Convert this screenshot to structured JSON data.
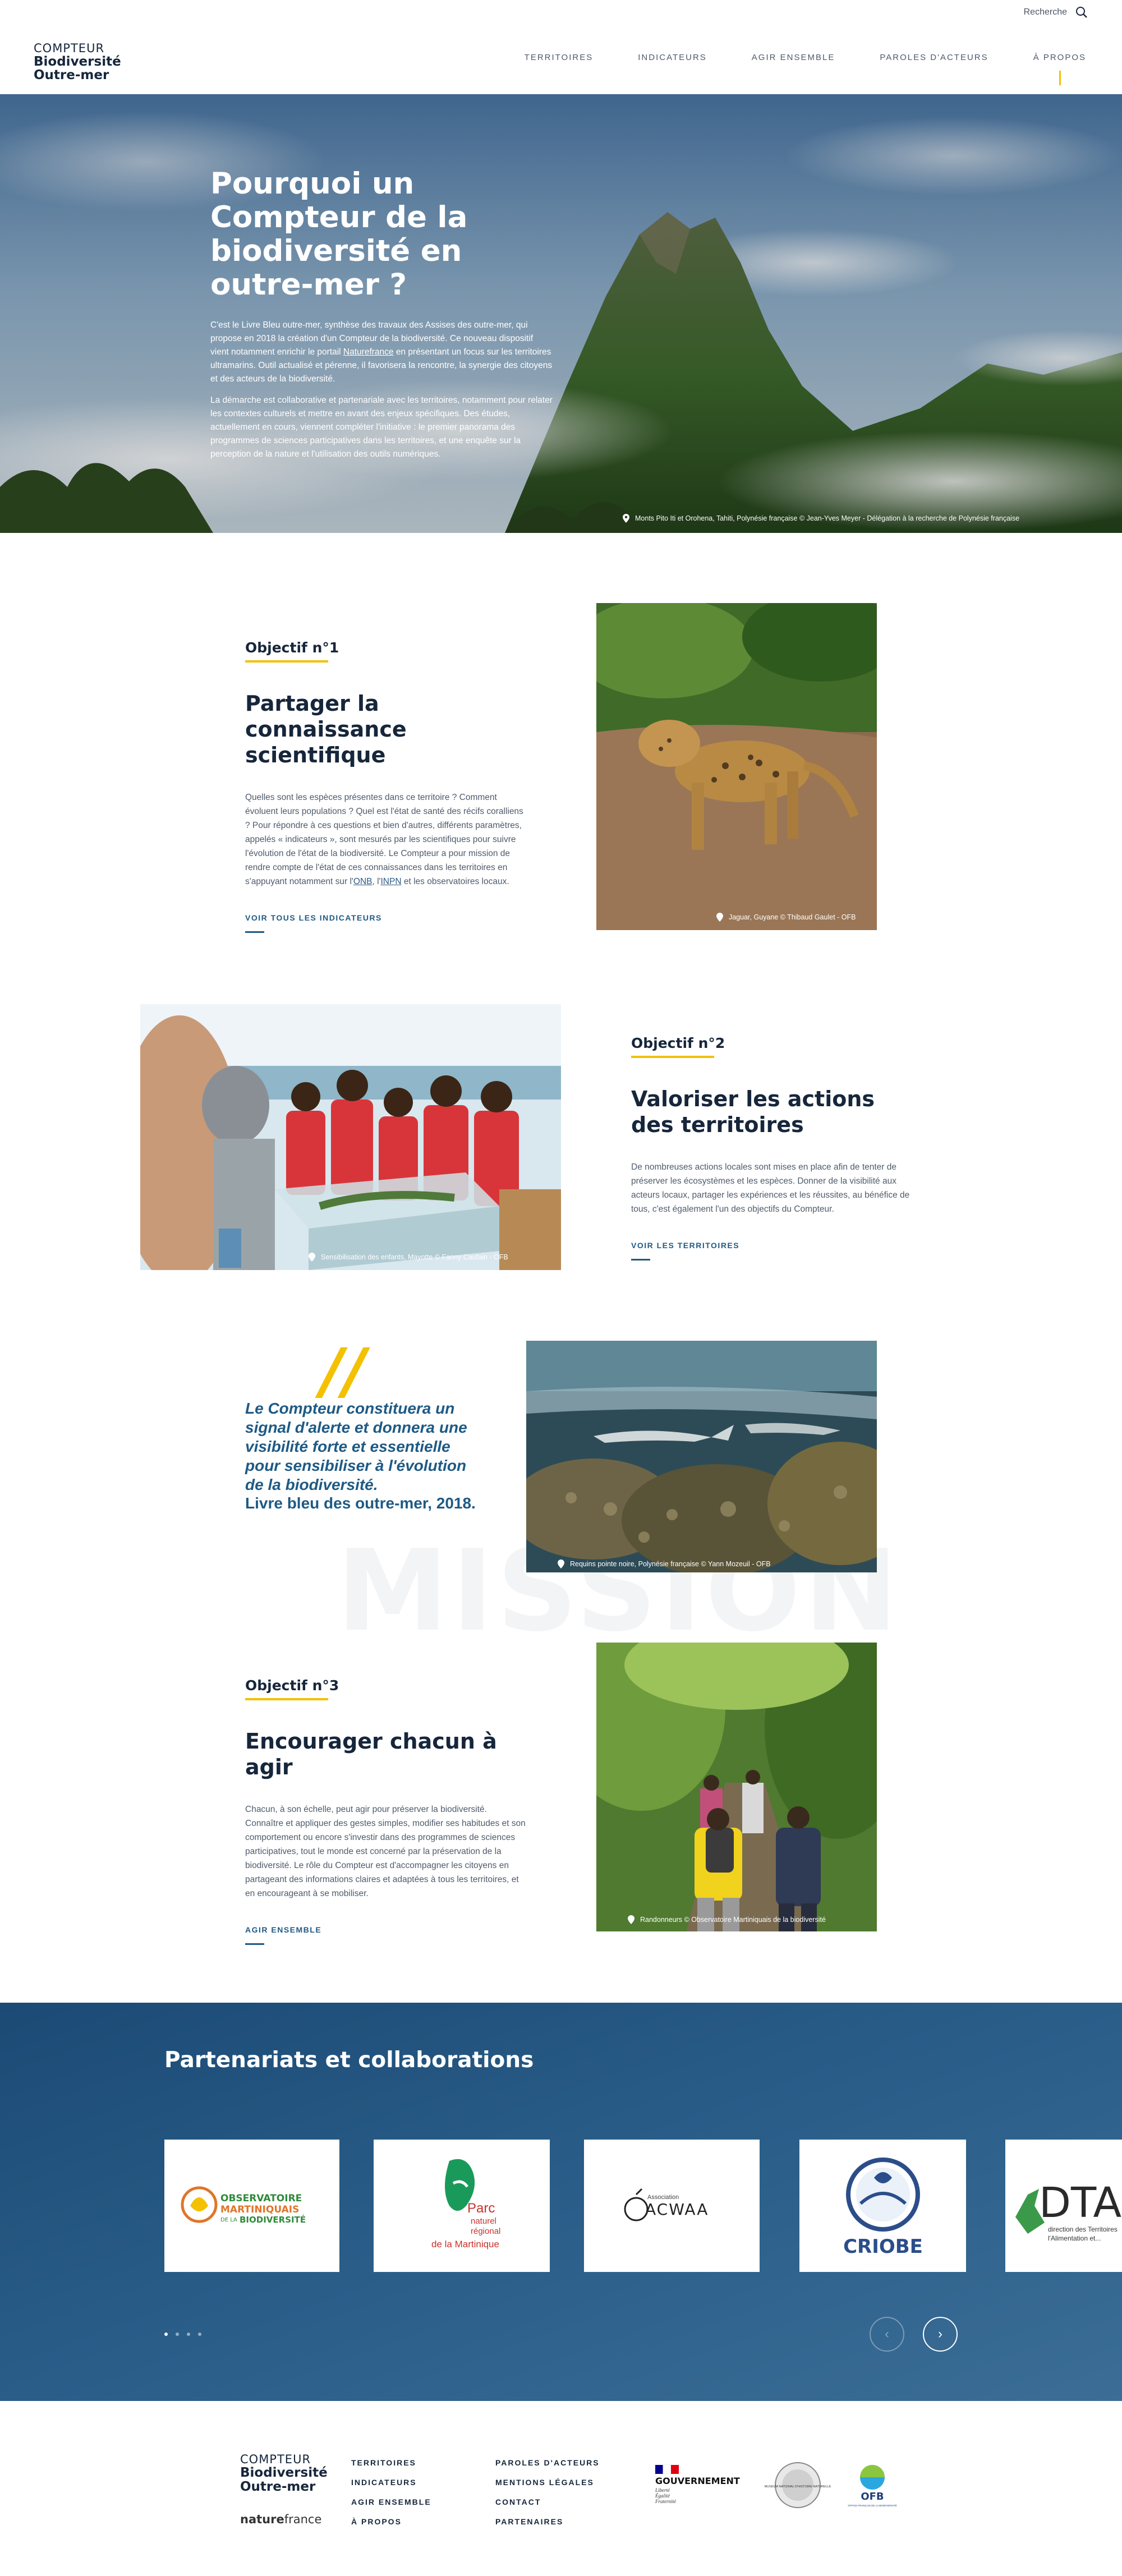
{
  "header": {
    "search_label": "Recherche",
    "logo": {
      "line1": "COMPTEUR",
      "line2": "Biodiversité",
      "line3": "Outre-mer"
    },
    "nav": [
      {
        "label": "TERRITOIRES"
      },
      {
        "label": "INDICATEURS"
      },
      {
        "label": "AGIR ENSEMBLE"
      },
      {
        "label": "PAROLES D'ACTEURS"
      },
      {
        "label": "À PROPOS"
      }
    ]
  },
  "hero": {
    "title": "Pourquoi un Compteur de la biodiversité en outre-mer ?",
    "p1_a": "C'est le Livre Bleu outre-mer, synthèse des travaux des Assises des outre-mer, qui propose en 2018 la création d'un Compteur de la biodiversité. Ce nouveau dispositif vient notamment enrichir le portail ",
    "p1_link": "Naturefrance",
    "p1_b": " en présentant un focus sur les territoires ultramarins. Outil actualisé et pérenne, il favorisera la rencontre, la synergie des citoyens et des acteurs de la biodiversité.",
    "p2": "La démarche est collaborative et partenariale avec les territoires, notamment pour relater les contextes culturels et mettre en avant des enjeux spécifiques. Des études, actuellement en cours, viennent compléter l'initiative : le premier panorama des programmes de sciences participatives dans les territoires, et une enquête sur la perception de la nature et l'utilisation des outils numériques.",
    "caption": "Monts Pito Iti et Orohena, Tahiti, Polynésie française © Jean-Yves Meyer - Délégation à la recherche de Polynésie française"
  },
  "objectives": [
    {
      "tag": "Objectif n°1",
      "title": "Partager la connaissance scientifique",
      "text_a": "Quelles sont les espèces présentes dans ce territoire ? Comment évoluent leurs populations ? Quel est l'état de santé des récifs coralliens ? Pour répondre à ces questions et bien d'autres, différents paramètres, appelés « indicateurs », sont mesurés par les scientifiques pour suivre l'évolution de l'état de la biodiversité. Le Compteur a pour mission de rendre compte de l'état de ces connaissances dans les territoires en s'appuyant notamment sur l'",
      "link1": "ONB",
      "text_b": ", l'",
      "link2": "INPN",
      "text_c": " et les observatoires locaux.",
      "more": "VOIR TOUS LES INDICATEURS",
      "caption": "Jaguar, Guyane © Thibaud Gaulet - OFB"
    },
    {
      "tag": "Objectif n°2",
      "title": "Valoriser les actions des territoires",
      "text": "De nombreuses actions locales sont mises en place afin de tenter de préserver les écosystèmes et les espèces. Donner de la visibilité aux acteurs locaux, partager les expériences et les réussites, au bénéfice de tous, c'est également l'un des objectifs du Compteur.",
      "more": "VOIR LES TERRITOIRES",
      "caption": "Sensibilisation des enfants, Mayotte © Fanny Cautain - OFB"
    },
    {
      "tag": "Objectif n°3",
      "title": "Encourager chacun à agir",
      "text": "Chacun, à son échelle, peut agir pour préserver la biodiversité. Connaître et appliquer des gestes simples, modifier ses habitudes et son comportement ou encore s'investir dans des programmes de sciences participatives, tout le monde est concerné par la préservation de la biodiversité. Le rôle du Compteur est d'accompagner les citoyens en partageant des informations claires et adaptées à tous les territoires, et en encourageant à se mobiliser.",
      "more": "AGIR ENSEMBLE",
      "caption": "Randonneurs © Observatoire Martiniquais de la biodiversité"
    }
  ],
  "quote": {
    "mark": "//",
    "text": "Le Compteur constituera un signal d'alerte et donnera une visibilité forte et essentielle pour sensibiliser à l'évolution de la biodiversité.",
    "source": "Livre bleu des outre-mer, 2018.",
    "caption": "Requins pointe noire, Polynésie française © Yann Mozeuil - OFB",
    "watermark": "MISSION"
  },
  "partners": {
    "title": "Partenariats et collaborations",
    "cards": [
      {
        "l1": "OBSERVATOIRE",
        "l2": "MARTINIQUAIS",
        "l3": "DE LA",
        "l4": "BIODIVERSITÉ"
      },
      {
        "l1": "Parc",
        "l2": "naturel",
        "l3": "régional",
        "l4": "de la Martinique"
      },
      {
        "l1": "Association",
        "l2": "ACWAA"
      },
      {
        "l1": "CRIOBE"
      },
      {
        "l1": "DTA",
        "l2": "direction des Territoires",
        "l3": "l'Alimentation et..."
      }
    ],
    "prev": "‹",
    "next": "›"
  },
  "footer": {
    "logo": {
      "line1": "COMPTEUR",
      "line2": "Biodiversité",
      "line3": "Outre-mer",
      "nf_a": "nature",
      "nf_b": "france"
    },
    "col1": [
      "TERRITOIRES",
      "INDICATEURS",
      "AGIR ENSEMBLE",
      "À PROPOS"
    ],
    "col2": [
      "PAROLES D'ACTEURS",
      "MENTIONS LÉGALES",
      "CONTACT",
      "PARTENAIRES"
    ],
    "gov": {
      "l1": "GOUVERNEMENT",
      "l2": "Liberté",
      "l3": "Égalité",
      "l4": "Fraternité"
    },
    "mnhn": "MUSÉUM NATIONAL D'HISTOIRE NATURELLE",
    "ofb": "OFB",
    "ofb_sub": "OFFICE FRANÇAIS DE LA BIODIVERSITÉ"
  },
  "colors": {
    "accent": "#f3c100",
    "navy": "#16263b",
    "link": "#1e5a85",
    "band": "#1b4a75"
  },
  "icons": [
    "search-icon",
    "location-pin-icon",
    "chevron-left-icon",
    "chevron-right-icon"
  ]
}
